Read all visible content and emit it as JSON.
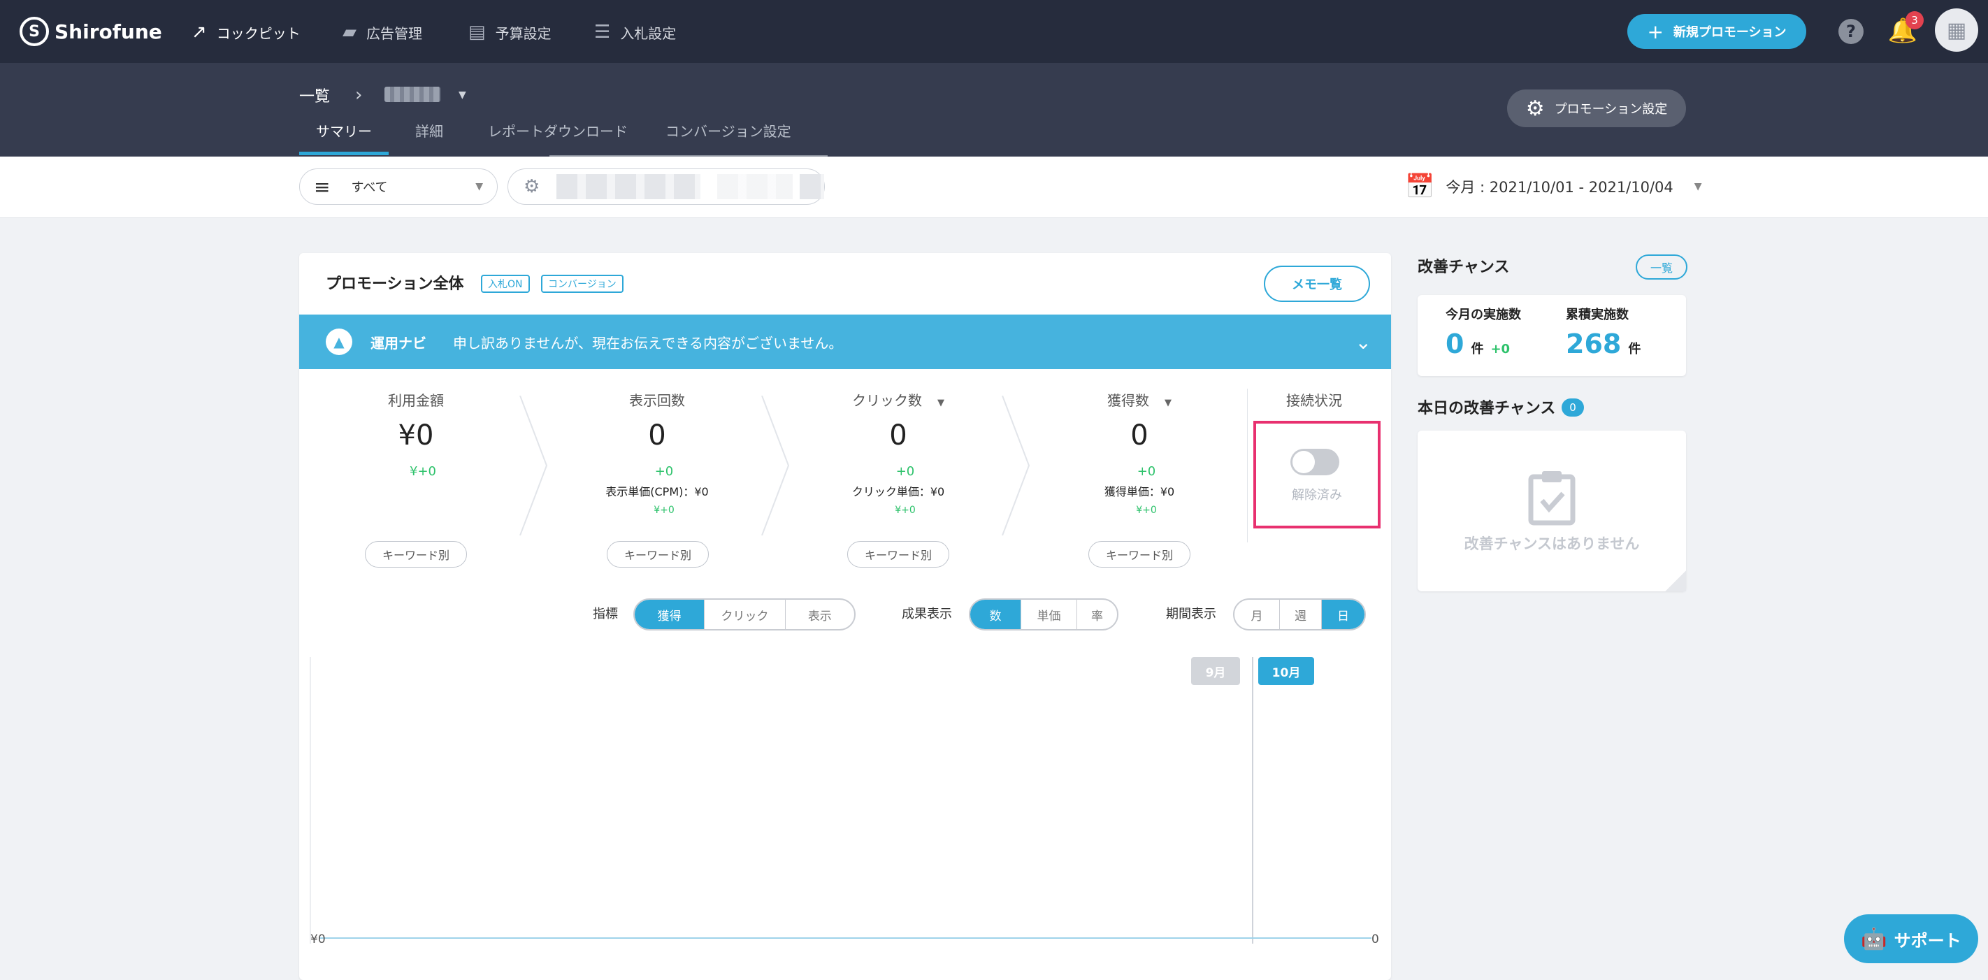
{
  "brand": "Shirofune",
  "nav": {
    "items": [
      {
        "label": "コックピット",
        "icon": "trend-icon"
      },
      {
        "label": "広告管理",
        "icon": "folder-icon"
      },
      {
        "label": "予算設定",
        "icon": "wallet-icon"
      },
      {
        "label": "入札設定",
        "icon": "sliders-icon"
      }
    ],
    "new_promotion": "新規プロモーション",
    "notification_count": "3"
  },
  "subheader": {
    "breadcrumb_root": "一覧",
    "tabs": [
      "サマリー",
      "詳細",
      "レポートダウンロード",
      "コンバージョン設定"
    ],
    "promotion_settings": "プロモーション設定"
  },
  "filter": {
    "select_value": "すべて",
    "date_range": "今月 : 2021/10/01 - 2021/10/04"
  },
  "main": {
    "title": "プロモーション全体",
    "tags": [
      "入札ON",
      "コンバージョン"
    ],
    "memo_button": "メモ一覧",
    "navi": {
      "label": "運用ナビ",
      "message": "申し訳ありませんが、現在お伝えできる内容がございません。"
    },
    "metrics": [
      {
        "label": "利用金額",
        "value": "¥0",
        "delta": "¥+0",
        "unit_label": "",
        "unit_delta": "",
        "button": "キーワード別"
      },
      {
        "label": "表示回数",
        "value": "0",
        "delta": "+0",
        "unit_label": "表示単価(CPM)：¥0",
        "unit_delta": "¥+0",
        "button": "キーワード別"
      },
      {
        "label": "クリック数",
        "value": "0",
        "delta": "+0",
        "unit_label": "クリック単価：¥0",
        "unit_delta": "¥+0",
        "button": "キーワード別"
      },
      {
        "label": "獲得数",
        "value": "0",
        "delta": "+0",
        "unit_label": "獲得単価：¥0",
        "unit_delta": "¥+0",
        "button": "キーワード別"
      }
    ],
    "connection": {
      "label": "接続状況",
      "status": "解除済み",
      "enabled": false
    },
    "controls": {
      "metric_label": "指標",
      "metric_options": [
        "獲得",
        "クリック",
        "表示"
      ],
      "metric_selected": "獲得",
      "result_label": "成果表示",
      "result_options": [
        "数",
        "単価",
        "率"
      ],
      "result_selected": "数",
      "period_label": "期間表示",
      "period_options": [
        "月",
        "週",
        "日"
      ],
      "period_selected": "日"
    },
    "chart": {
      "month_prev": "9月",
      "month_current": "10月",
      "y_left_label": "¥0",
      "y_right_label": "0"
    }
  },
  "chart_data": {
    "type": "line",
    "title": "",
    "series": [
      {
        "values": [
          0,
          0,
          0,
          0
        ]
      }
    ],
    "x": [
      "9月",
      "10月"
    ],
    "ylabel_left": "¥0",
    "ylabel_right": "0"
  },
  "side": {
    "kaizen_title": "改善チャンス",
    "list_button": "一覧",
    "this_month_label": "今月の実施数",
    "this_month_value": "0",
    "this_month_unit": "件",
    "this_month_delta": "+0",
    "total_label": "累積実施数",
    "total_value": "268",
    "total_unit": "件",
    "today_title": "本日の改善チャンス",
    "today_count": "0",
    "empty_message": "改善チャンスはありません"
  },
  "support": "サポート",
  "colors": {
    "accent": "#2ea8d8",
    "nav_bg": "#262c3d",
    "positive": "#2dc26b",
    "highlight": "#e8306f"
  }
}
